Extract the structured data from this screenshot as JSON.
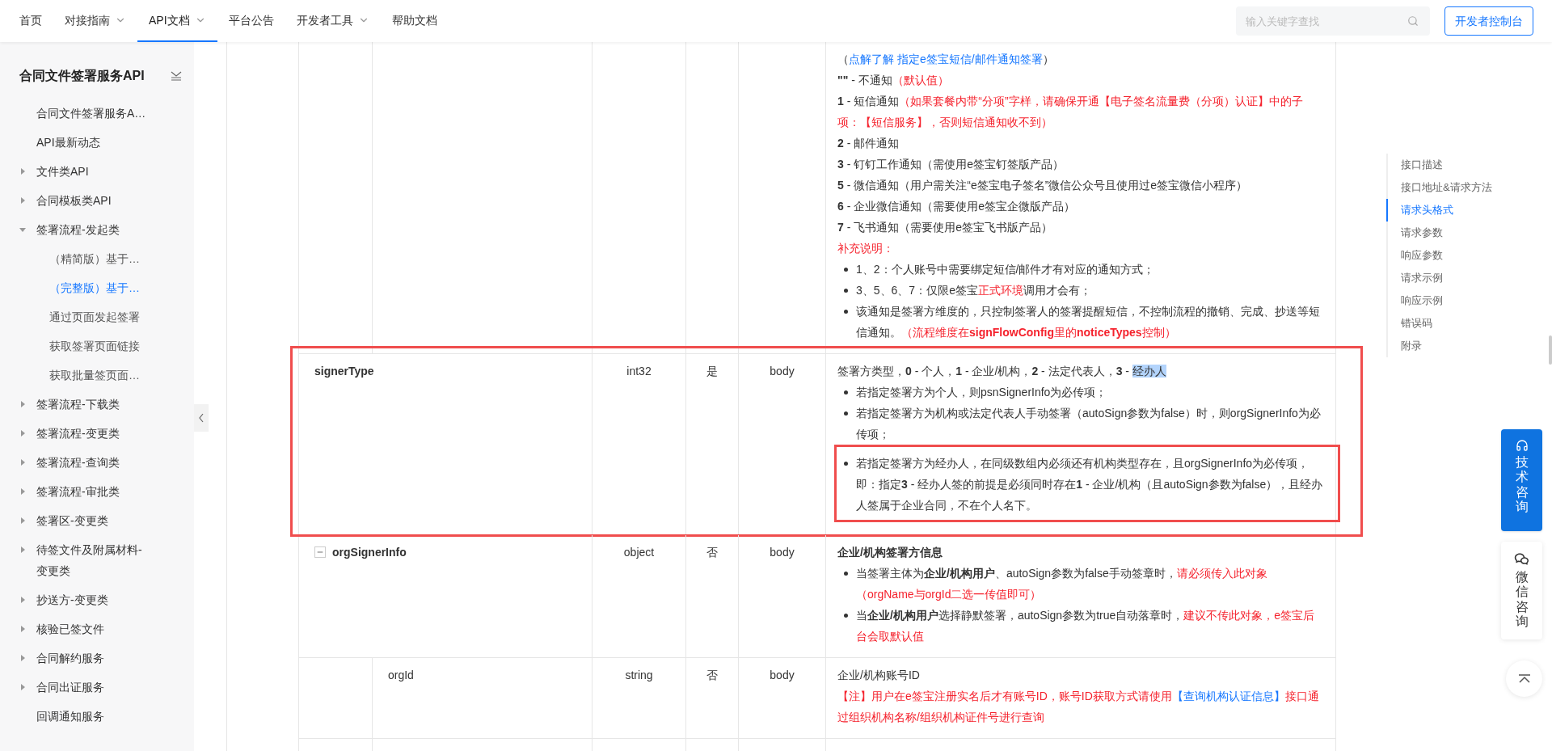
{
  "nav": {
    "items": [
      {
        "label": "首页",
        "has_menu": false,
        "selected": false
      },
      {
        "label": "对接指南",
        "has_menu": true,
        "selected": false
      },
      {
        "label": "API文档",
        "has_menu": true,
        "selected": true
      },
      {
        "label": "平台公告",
        "has_menu": false,
        "selected": false
      },
      {
        "label": "开发者工具",
        "has_menu": true,
        "selected": false
      },
      {
        "label": "帮助文档",
        "has_menu": false,
        "selected": false
      }
    ],
    "search": {
      "placeholder": "输入关键字查找"
    },
    "console_button": "开发者控制台"
  },
  "sidebar": {
    "title": "合同文件签署服务API",
    "items": [
      {
        "label": "合同文件签署服务A…",
        "kind": "page",
        "selected": false
      },
      {
        "label": "API最新动态",
        "kind": "page",
        "selected": false
      },
      {
        "label": "文件类API",
        "kind": "group",
        "expanded": false,
        "selected": false
      },
      {
        "label": "合同模板类API",
        "kind": "group",
        "expanded": false,
        "selected": false
      },
      {
        "label": "签署流程-发起类",
        "kind": "group",
        "expanded": true,
        "selected": false,
        "children": [
          {
            "label": "（精简版）基于…",
            "selected": false
          },
          {
            "label": "（完整版）基于…",
            "selected": true
          },
          {
            "label": "通过页面发起签署",
            "selected": false
          },
          {
            "label": "获取签署页面链接",
            "selected": false
          },
          {
            "label": "获取批量签页面…",
            "selected": false
          }
        ]
      },
      {
        "label": "签署流程-下载类",
        "kind": "group",
        "expanded": false,
        "selected": false
      },
      {
        "label": "签署流程-变更类",
        "kind": "group",
        "expanded": false,
        "selected": false
      },
      {
        "label": "签署流程-查询类",
        "kind": "group",
        "expanded": false,
        "selected": false
      },
      {
        "label": "签署流程-审批类",
        "kind": "group",
        "expanded": false,
        "selected": false
      },
      {
        "label": "签署区-变更类",
        "kind": "group",
        "expanded": false,
        "selected": false
      },
      {
        "label": "待签文件及附属材料-变更类",
        "kind": "group",
        "expanded": false,
        "selected": false
      },
      {
        "label": "抄送方-变更类",
        "kind": "group",
        "expanded": false,
        "selected": false
      },
      {
        "label": "核验已签文件",
        "kind": "group",
        "expanded": false,
        "selected": false
      },
      {
        "label": "合同解约服务",
        "kind": "group",
        "expanded": false,
        "selected": false
      },
      {
        "label": "合同出证服务",
        "kind": "group",
        "expanded": false,
        "selected": false
      },
      {
        "label": "回调通知服务",
        "kind": "page",
        "selected": false
      }
    ]
  },
  "table": {
    "rows": [
      {
        "children": [
          {
            "highlighted": false,
            "description": [
              {
                "kind": "line",
                "segments": [
                  {
                    "kind": "plain",
                    "text": "（"
                  },
                  {
                    "kind": "link",
                    "text": "点解了解 指定e签宝短信/邮件通知签署"
                  },
                  {
                    "kind": "plain",
                    "text": "）"
                  }
                ]
              },
              {
                "kind": "line",
                "segments": [
                  {
                    "kind": "plain",
                    "text": "**\"\"** - 不通知"
                  },
                  {
                    "kind": "red",
                    "text": "（默认值）"
                  }
                ]
              },
              {
                "kind": "line",
                "segments": [
                  {
                    "kind": "plain",
                    "text": "**1** - 短信通知"
                  },
                  {
                    "kind": "red",
                    "text": "（如果套餐内带“分项”字样，请确保开通【电子签名流量费（分项）认证】中的子项：【短信服务】，否则短信通知收不到）"
                  }
                ]
              },
              {
                "kind": "line",
                "segments": [
                  {
                    "kind": "plain",
                    "text": "**2** - 邮件通知"
                  }
                ]
              },
              {
                "kind": "line",
                "segments": [
                  {
                    "kind": "plain",
                    "text": "**3** - 钉钉工作通知（需使用e签宝钉签版产品）"
                  }
                ]
              },
              {
                "kind": "line",
                "segments": [
                  {
                    "kind": "plain",
                    "text": "**5** - 微信通知（用户需关注“e签宝电子签名”微信公众号且使用过e签宝微信小程序）"
                  }
                ]
              },
              {
                "kind": "line",
                "segments": [
                  {
                    "kind": "plain",
                    "text": "**6** - 企业微信通知（需要使用e签宝企微版产品）"
                  }
                ]
              },
              {
                "kind": "line",
                "segments": [
                  {
                    "kind": "plain",
                    "text": "**7** - 飞书通知（需要使用e签宝飞书版产品）"
                  }
                ]
              },
              {
                "kind": "line",
                "segments": [
                  {
                    "kind": "red",
                    "text": "补充说明："
                  }
                ]
              },
              {
                "kind": "list",
                "items": [
                  {
                    "highlighted": false,
                    "segments": [
                      {
                        "kind": "plain",
                        "text": "1、2：个人账号中需要绑定短信/邮件才有对应的通知方式；"
                      }
                    ]
                  },
                  {
                    "highlighted": false,
                    "segments": [
                      {
                        "kind": "plain",
                        "text": "3、5、6、7：仅限e签宝"
                      },
                      {
                        "kind": "red",
                        "text": "正式环境"
                      },
                      {
                        "kind": "plain",
                        "text": "调用才会有；"
                      }
                    ]
                  },
                  {
                    "highlighted": false,
                    "segments": [
                      {
                        "kind": "plain",
                        "text": "该通知是签署方维度的，只控制签署人的签署提醒短信，不控制流程的撤销、完成、抄送等短信通知。"
                      },
                      {
                        "kind": "red",
                        "text": "（流程维度在**signFlowConfig**里的**noticeTypes**控制）"
                      }
                    ]
                  }
                ]
              }
            ]
          }
        ]
      },
      {
        "name": "signerType",
        "type": "int32",
        "required": "是",
        "position": "body",
        "highlighted": true,
        "description": [
          {
            "kind": "line",
            "segments": [
              {
                "kind": "plain",
                "text": "签署方类型，**0** - 个人，**1** - 企业/机构，**2** - 法定代表人，**3** - "
              },
              {
                "kind": "mark",
                "text": "经办人"
              }
            ]
          },
          {
            "kind": "list",
            "items": [
              {
                "highlighted": false,
                "segments": [
                  {
                    "kind": "plain",
                    "text": "若指定签署方为个人，则psnSignerInfo为必传项；"
                  }
                ]
              },
              {
                "highlighted": false,
                "segments": [
                  {
                    "kind": "plain",
                    "text": "若指定签署方为机构或法定代表人手动签署（autoSign参数为false）时，则orgSignerInfo为必传项；"
                  }
                ]
              },
              {
                "highlighted": true,
                "segments": [
                  {
                    "kind": "plain",
                    "text": "若指定签署方为经办人，在同级数组内必须还有机构类型存在，且orgSignerInfo为必传项，即：指定**3** - 经办人签的前提是必须同时存在**1** - 企业/机构（且autoSign参数为false），且经办人签属于企业合同，不在个人名下。"
                  }
                ]
              }
            ]
          }
        ]
      },
      {
        "name": "orgSignerInfo",
        "expanded": true,
        "type": "object",
        "required": "否",
        "position": "body",
        "highlighted": false,
        "description": [
          {
            "kind": "line",
            "segments": [
              {
                "kind": "plain",
                "text": "**企业/机构签署方信息**"
              }
            ]
          },
          {
            "kind": "list",
            "items": [
              {
                "highlighted": false,
                "segments": [
                  {
                    "kind": "plain",
                    "text": "当签署主体为**企业/机构用户**、autoSign参数为false手动签章时，"
                  },
                  {
                    "kind": "red",
                    "text": "请必须传入此对象（orgName与orgId二选一传值即可）"
                  }
                ]
              },
              {
                "highlighted": false,
                "segments": [
                  {
                    "kind": "plain",
                    "text": "当**企业/机构用户**选择静默签署，autoSign参数为true自动落章时，"
                  },
                  {
                    "kind": "red",
                    "text": "建议不传此对象，e签宝后台会取默认值"
                  }
                ]
              }
            ]
          }
        ],
        "children": [
          {
            "name": "orgId",
            "type": "string",
            "required": "否",
            "position": "body",
            "highlighted": false,
            "description": [
              {
                "kind": "line",
                "segments": [
                  {
                    "kind": "plain",
                    "text": "企业/机构账号ID"
                  }
                ]
              },
              {
                "kind": "line",
                "segments": [
                  {
                    "kind": "red",
                    "text": "【注】用户在e签宝注册实名后才有账号ID，账号ID获取方式请使用"
                  },
                  {
                    "kind": "link",
                    "text": "【查询机构认证信息】"
                  },
                  {
                    "kind": "red",
                    "text": "接口通过组织机构名称/组织机构证件号进行查询"
                  }
                ]
              }
            ]
          }
        ]
      }
    ]
  },
  "toc": {
    "items": [
      {
        "label": "接口描述",
        "selected": false
      },
      {
        "label": "接口地址&请求方法",
        "selected": false
      },
      {
        "label": "请求头格式",
        "selected": true
      },
      {
        "label": "请求参数",
        "selected": false
      },
      {
        "label": "响应参数",
        "selected": false
      },
      {
        "label": "请求示例",
        "selected": false
      },
      {
        "label": "响应示例",
        "selected": false
      },
      {
        "label": "错误码",
        "selected": false
      },
      {
        "label": "附录",
        "selected": false
      }
    ]
  },
  "float_buttons": [
    {
      "kind": "tech",
      "label": "技术咨询"
    },
    {
      "kind": "wechat",
      "label": "微信咨询"
    },
    {
      "kind": "top"
    }
  ]
}
